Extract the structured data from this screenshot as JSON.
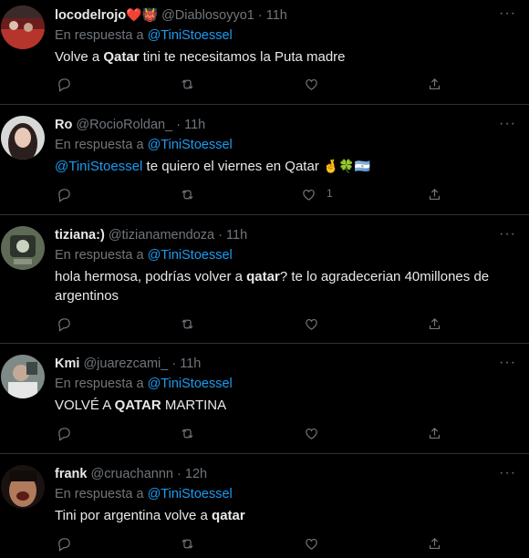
{
  "tweets": [
    {
      "name": "locodelrojo",
      "name_suffix": "❤️👹",
      "handle": "@Diablosoyyo1",
      "time": "11h",
      "reply_prefix": "En respuesta a",
      "reply_to": "@TiniStoessel",
      "text_parts": [
        "Volve a ",
        "Qatar",
        " tini te necesitamos la Puta madre"
      ],
      "likes": ""
    },
    {
      "name": "Ro",
      "handle": "@RocioRoldan_",
      "time": "11h",
      "reply_prefix": "En respuesta a",
      "reply_to": "@TiniStoessel",
      "mention": "@TiniStoessel",
      "text_parts": [
        " te quiero el viernes en Qatar ",
        "🤞🍀🇦🇷"
      ],
      "likes": "1"
    },
    {
      "name": "tiziana:)",
      "handle": "@tizianamendoza",
      "time": "11h",
      "reply_prefix": "En respuesta a",
      "reply_to": "@TiniStoessel",
      "text_parts": [
        "hola hermosa, podrías volver a ",
        "qatar",
        "? te lo agradecerian 40millones de argentinos"
      ],
      "likes": ""
    },
    {
      "name": "Kmi",
      "handle": "@juarezcami_",
      "time": "11h",
      "reply_prefix": "En respuesta a",
      "reply_to": "@TiniStoessel",
      "text_parts": [
        "VOLVÉ A ",
        "QATAR",
        " MARTINA"
      ],
      "likes": ""
    },
    {
      "name": "frank",
      "handle": "@cruachannn",
      "time": "12h",
      "reply_prefix": "En respuesta a",
      "reply_to": "@TiniStoessel",
      "text_parts": [
        "Tini por argentina volve a ",
        "qatar"
      ],
      "likes": ""
    }
  ],
  "meta_sep": "·",
  "more_label": "···",
  "icons": [
    "reply-icon",
    "retweet-icon",
    "like-icon",
    "share-icon"
  ],
  "colors": {
    "background": "#000000",
    "text": "#e7e9ea",
    "muted": "#71767b",
    "link": "#1d9bf0",
    "divider": "#2f3336"
  }
}
